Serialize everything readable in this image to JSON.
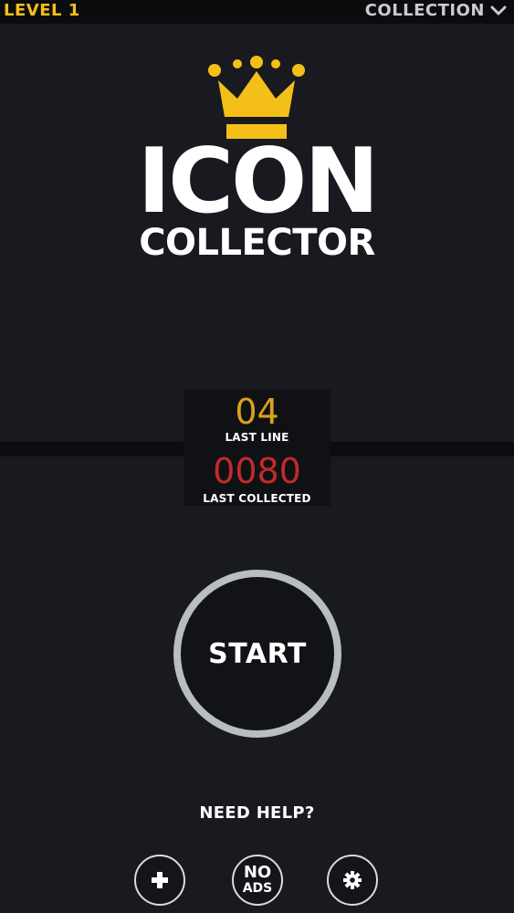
{
  "header": {
    "level_label": "LEVEL 1",
    "collection_label": "COLLECTION",
    "chevron_icon": "chevron-down-icon"
  },
  "logo": {
    "crown_icon": "crown-icon",
    "line1": "ICON",
    "line2": "COLLECTOR"
  },
  "stats": {
    "last_line_value": "04",
    "last_line_label": "LAST LINE",
    "last_collected_value": "0080",
    "last_collected_label": "LAST COLLECTED"
  },
  "start": {
    "label": "START"
  },
  "help": {
    "label": "NEED HELP?"
  },
  "bottom_buttons": {
    "add_icon": "plus-icon",
    "no_ads_line1": "NO",
    "no_ads_line2": "ADS",
    "settings_icon": "gear-icon"
  },
  "colors": {
    "accent_yellow": "#f5bf1a",
    "last_line_yellow": "#d9a21a",
    "last_collected_red": "#c12b2b",
    "background": "#181a1f"
  }
}
